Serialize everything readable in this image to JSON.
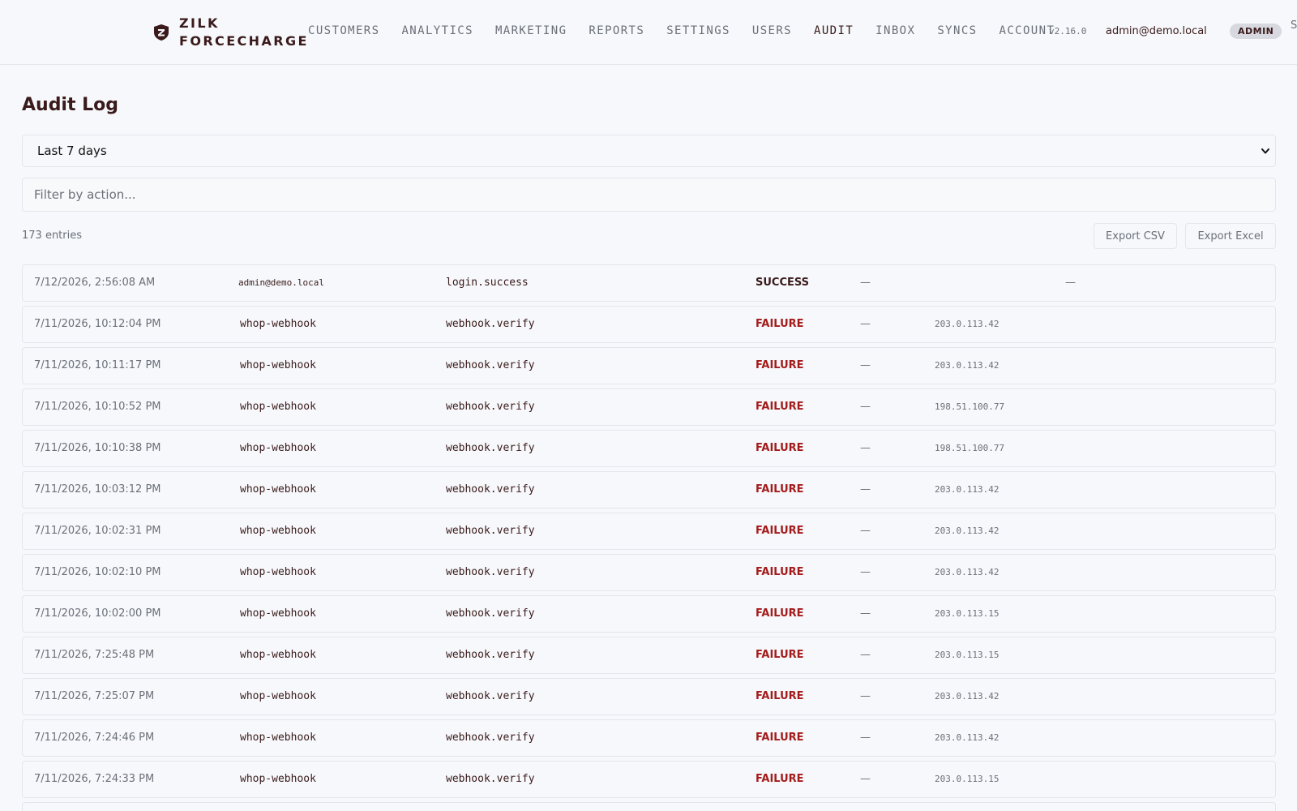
{
  "header": {
    "brand_line1": "ZILK",
    "brand_line2": "FORCECHARGE",
    "nav": [
      "CUSTOMERS",
      "ANALYTICS",
      "MARKETING",
      "REPORTS",
      "SETTINGS",
      "USERS",
      "AUDIT",
      "INBOX",
      "SYNCS",
      "ACCOUNT"
    ],
    "active_nav": "AUDIT",
    "version": "v2.16.0",
    "user_email": "admin@demo.local",
    "role": "ADMIN"
  },
  "main": {
    "title": "Audit Log",
    "range_selected": "Last 7 days",
    "filter_placeholder": "Filter by action...",
    "entry_count": "173 entries",
    "export_csv": "Export CSV",
    "export_excel": "Export Excel"
  },
  "entries": [
    {
      "time": "7/12/2026, 2:56:08 AM",
      "actor": "admin@demo.local",
      "action": "login.success",
      "status": "SUCCESS",
      "target": "—",
      "ip": "—"
    },
    {
      "time": "7/11/2026, 10:12:04 PM",
      "actor": "whop-webhook",
      "action": "webhook.verify",
      "status": "FAILURE",
      "target": "—",
      "ip": "203.0.113.42"
    },
    {
      "time": "7/11/2026, 10:11:17 PM",
      "actor": "whop-webhook",
      "action": "webhook.verify",
      "status": "FAILURE",
      "target": "—",
      "ip": "203.0.113.42"
    },
    {
      "time": "7/11/2026, 10:10:52 PM",
      "actor": "whop-webhook",
      "action": "webhook.verify",
      "status": "FAILURE",
      "target": "—",
      "ip": "198.51.100.77"
    },
    {
      "time": "7/11/2026, 10:10:38 PM",
      "actor": "whop-webhook",
      "action": "webhook.verify",
      "status": "FAILURE",
      "target": "—",
      "ip": "198.51.100.77"
    },
    {
      "time": "7/11/2026, 10:03:12 PM",
      "actor": "whop-webhook",
      "action": "webhook.verify",
      "status": "FAILURE",
      "target": "—",
      "ip": "203.0.113.42"
    },
    {
      "time": "7/11/2026, 10:02:31 PM",
      "actor": "whop-webhook",
      "action": "webhook.verify",
      "status": "FAILURE",
      "target": "—",
      "ip": "203.0.113.42"
    },
    {
      "time": "7/11/2026, 10:02:10 PM",
      "actor": "whop-webhook",
      "action": "webhook.verify",
      "status": "FAILURE",
      "target": "—",
      "ip": "203.0.113.42"
    },
    {
      "time": "7/11/2026, 10:02:00 PM",
      "actor": "whop-webhook",
      "action": "webhook.verify",
      "status": "FAILURE",
      "target": "—",
      "ip": "203.0.113.15"
    },
    {
      "time": "7/11/2026, 7:25:48 PM",
      "actor": "whop-webhook",
      "action": "webhook.verify",
      "status": "FAILURE",
      "target": "—",
      "ip": "203.0.113.15"
    },
    {
      "time": "7/11/2026, 7:25:07 PM",
      "actor": "whop-webhook",
      "action": "webhook.verify",
      "status": "FAILURE",
      "target": "—",
      "ip": "203.0.113.42"
    },
    {
      "time": "7/11/2026, 7:24:46 PM",
      "actor": "whop-webhook",
      "action": "webhook.verify",
      "status": "FAILURE",
      "target": "—",
      "ip": "203.0.113.42"
    },
    {
      "time": "7/11/2026, 7:24:33 PM",
      "actor": "whop-webhook",
      "action": "webhook.verify",
      "status": "FAILURE",
      "target": "—",
      "ip": "203.0.113.15"
    }
  ],
  "colors": {
    "accent": "#3a1a1a",
    "failure": "#a41b1b",
    "muted": "#6b6f78",
    "border": "#e3e6ec",
    "background": "#f6f8fb"
  }
}
